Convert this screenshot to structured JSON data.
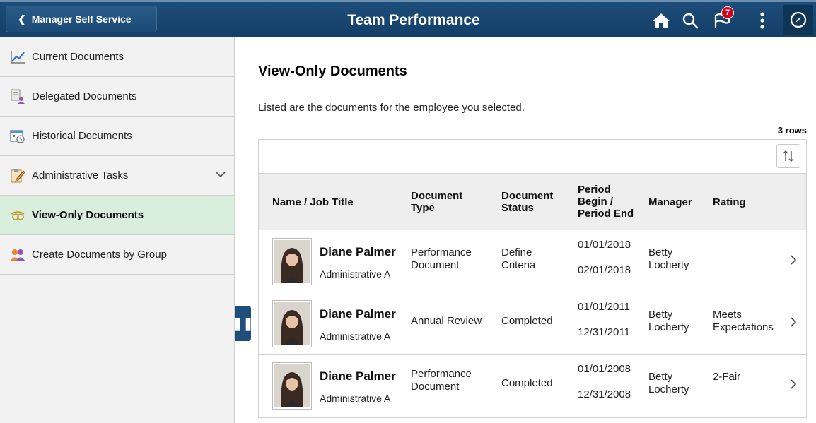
{
  "header": {
    "back_label": "Manager Self Service",
    "title": "Team Performance",
    "notification_count": "7"
  },
  "sidebar": {
    "items": [
      {
        "label": "Current Documents",
        "icon": "chart-line-icon"
      },
      {
        "label": "Delegated Documents",
        "icon": "delegated-doc-icon"
      },
      {
        "label": "Historical Documents",
        "icon": "calendar-clock-icon"
      },
      {
        "label": "Administrative Tasks",
        "icon": "clipboard-edit-icon"
      },
      {
        "label": "View-Only Documents",
        "icon": "glasses-icon"
      },
      {
        "label": "Create Documents by Group",
        "icon": "group-icon"
      }
    ]
  },
  "main": {
    "title": "View-Only Documents",
    "description": "Listed are the documents for the employee you selected.",
    "rows_count": "3 rows",
    "columns": {
      "name": "Name / Job Title",
      "doc_type_1": "Document",
      "doc_type_2": "Type",
      "doc_status_1": "Document",
      "doc_status_2": "Status",
      "period_1": "Period",
      "period_2": "Begin /",
      "period_3": "Period End",
      "manager": "Manager",
      "rating": "Rating"
    },
    "rows": [
      {
        "name": "Diane Palmer",
        "job": "Administrative A",
        "type_1": "Performance",
        "type_2": "Document",
        "status_1": "Define",
        "status_2": "Criteria",
        "begin": "01/01/2018",
        "end": "02/01/2018",
        "manager_1": "Betty",
        "manager_2": "Locherty",
        "rating_1": "",
        "rating_2": ""
      },
      {
        "name": "Diane Palmer",
        "job": "Administrative A",
        "type_1": "Annual Review",
        "type_2": "",
        "status_1": "Completed",
        "status_2": "",
        "begin": "01/01/2011",
        "end": "12/31/2011",
        "manager_1": "Betty",
        "manager_2": "Locherty",
        "rating_1": "Meets",
        "rating_2": "Expectations"
      },
      {
        "name": "Diane Palmer",
        "job": "Administrative A",
        "type_1": "Performance",
        "type_2": "Document",
        "status_1": "Completed",
        "status_2": "",
        "begin": "01/01/2008",
        "end": "12/31/2008",
        "manager_1": "Betty",
        "manager_2": "Locherty",
        "rating_1": "2-Fair",
        "rating_2": ""
      }
    ]
  },
  "colors": {
    "header_bg": "#1d4d7a",
    "active_item_bg": "#d9eedd",
    "badge": "#d0021b"
  }
}
